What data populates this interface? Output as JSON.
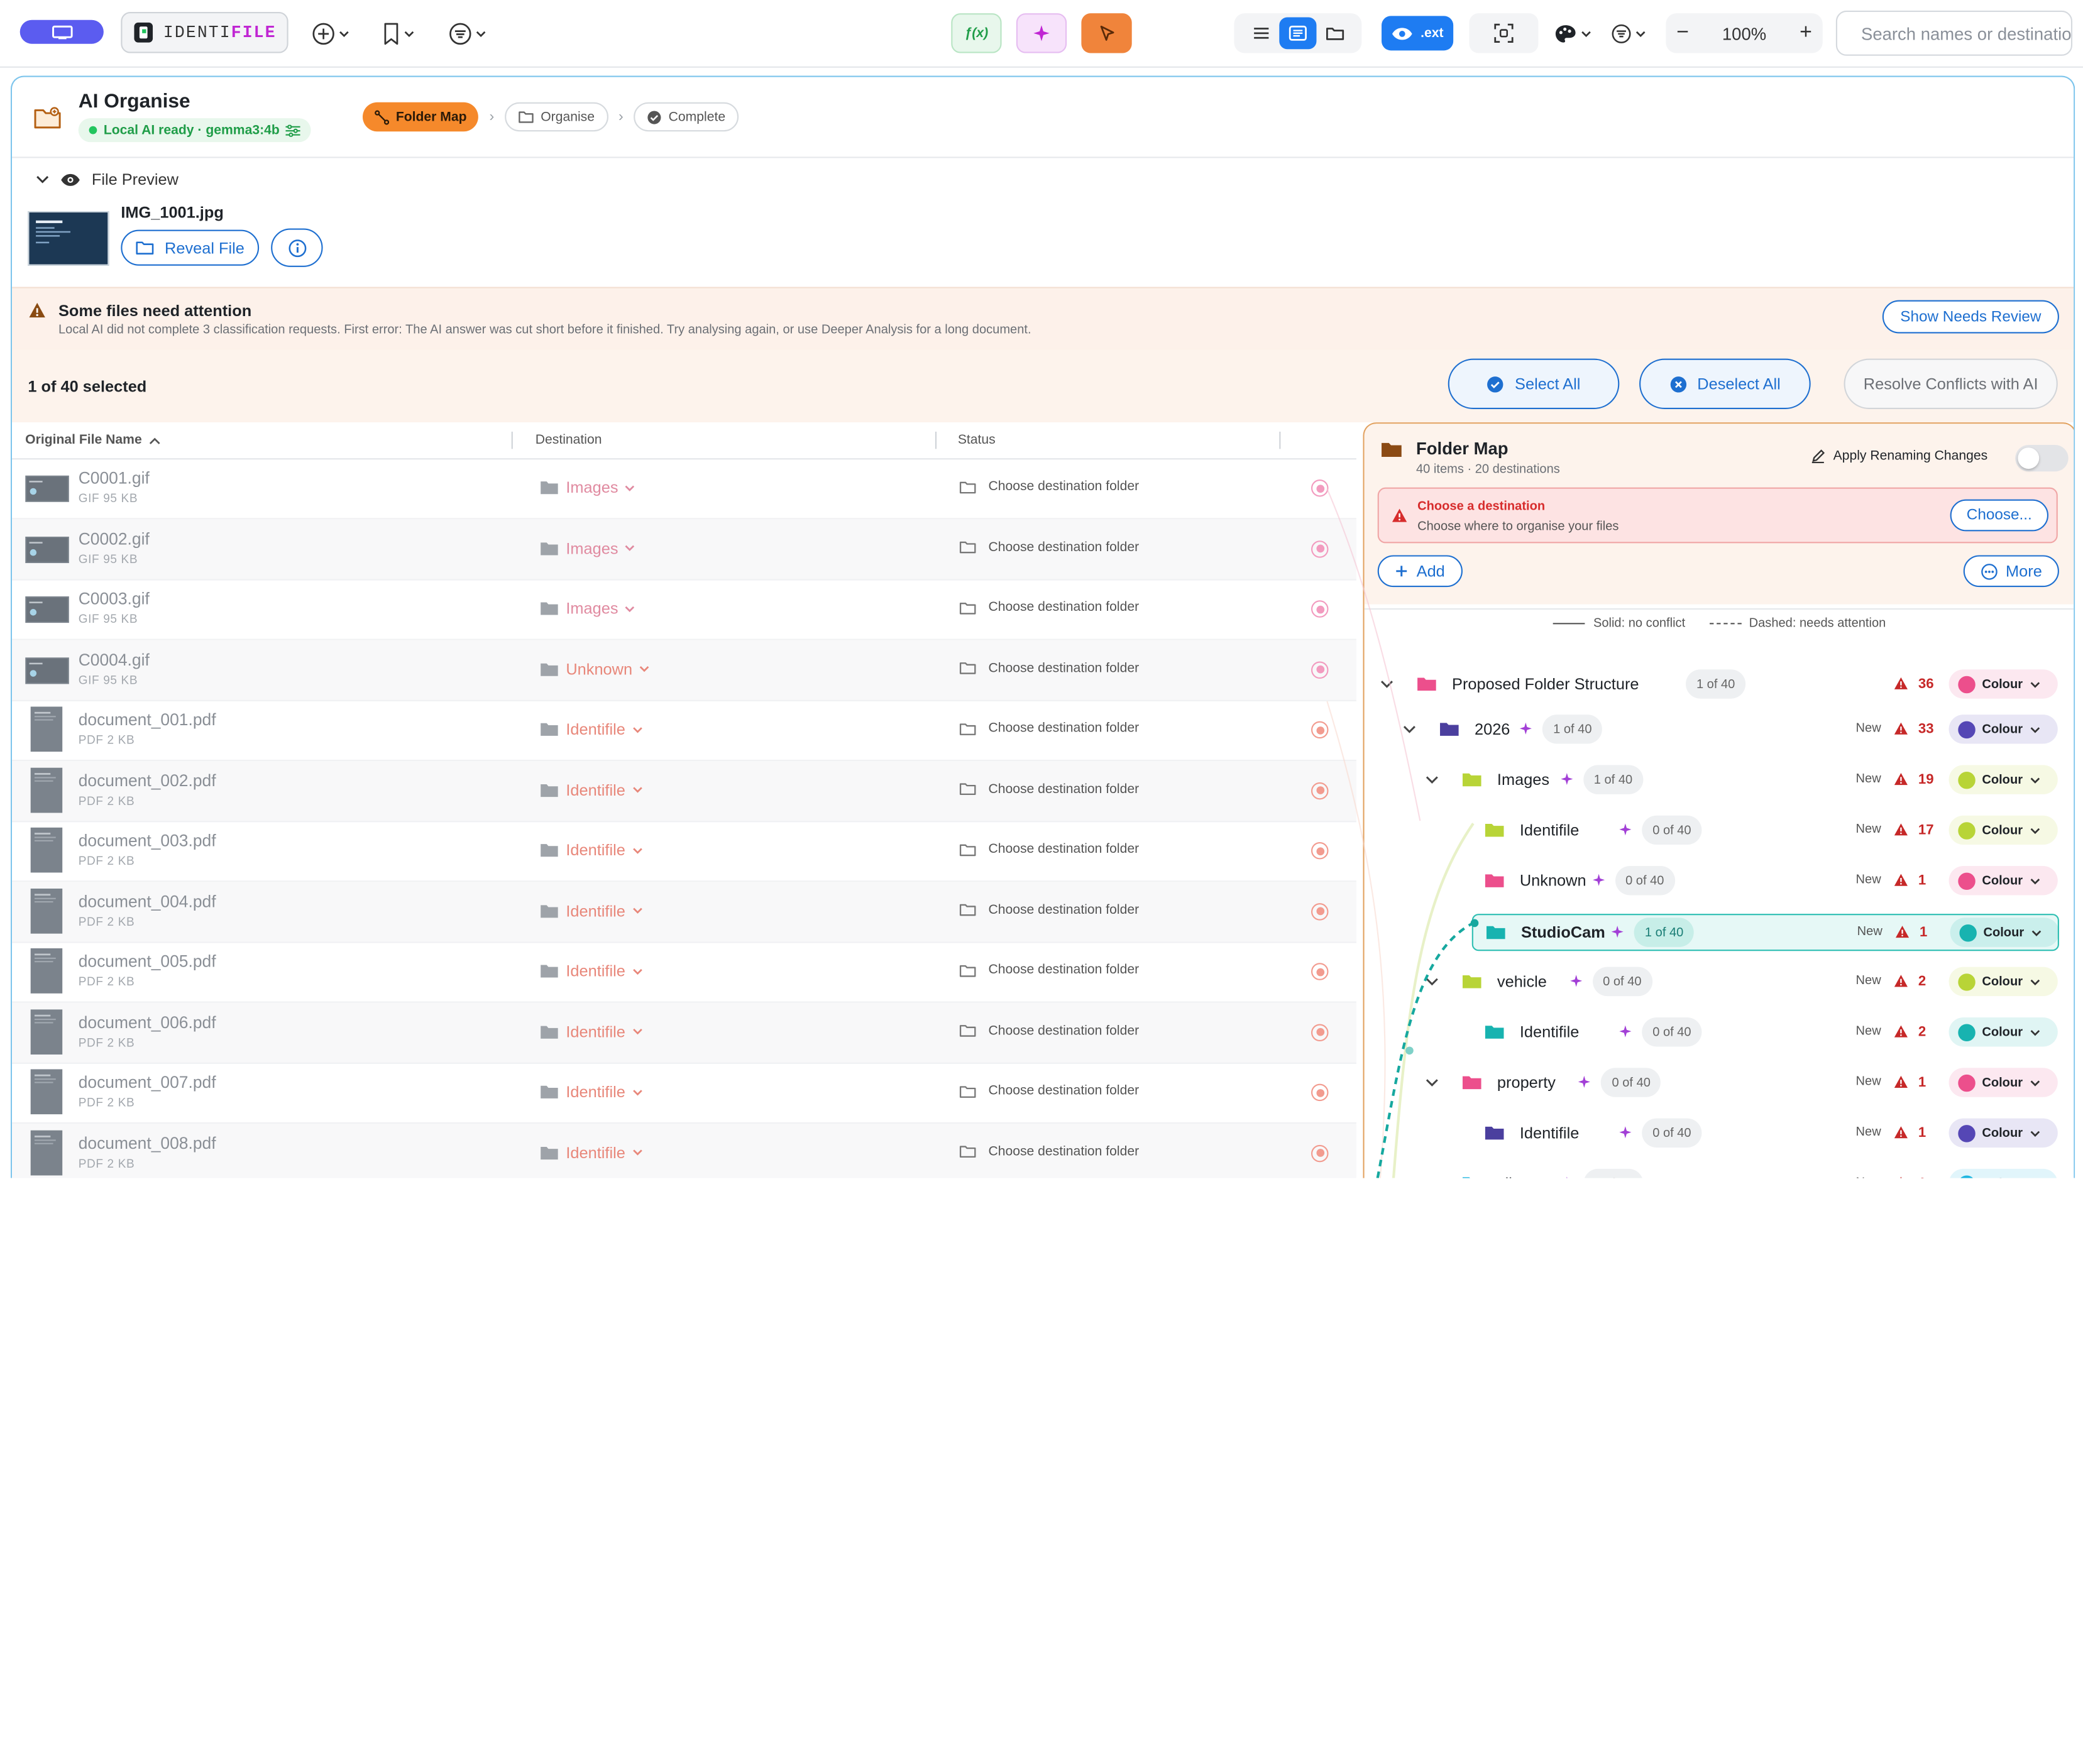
{
  "toolbar": {
    "brand_prefix": "IDENTI",
    "brand_suffix": "FILE",
    "fx_label": "ƒ(x)",
    "ext_label": ".ext",
    "zoom_minus": "−",
    "zoom_value": "100%",
    "zoom_plus": "+",
    "search_placeholder": "Search names or destinations"
  },
  "header": {
    "title": "AI Organise",
    "ai_status": "Local AI ready · gemma3:4b",
    "steps": [
      "Folder Map",
      "Organise",
      "Complete"
    ]
  },
  "preview": {
    "label": "File Preview",
    "file_name": "IMG_1001.jpg",
    "reveal_label": "Reveal File"
  },
  "warning": {
    "title": "Some files need attention",
    "message": "Local AI did not complete 3 classification requests. First error: The AI answer was cut short before it finished. Try analysing again, or use Deeper Analysis for a long document.",
    "button": "Show Needs Review"
  },
  "selection": {
    "count": "1 of 40 selected",
    "select_all": "Select All",
    "deselect_all": "Deselect All",
    "resolve": "Resolve Conflicts with AI"
  },
  "table": {
    "columns": [
      "Original File Name",
      "Destination",
      "Status"
    ],
    "status_text": "Choose destination folder",
    "rows": [
      {
        "name": "C0001.gif",
        "meta": "GIF  95 KB",
        "dest": "Images",
        "kind": "image"
      },
      {
        "name": "C0002.gif",
        "meta": "GIF  95 KB",
        "dest": "Images",
        "kind": "image"
      },
      {
        "name": "C0003.gif",
        "meta": "GIF  95 KB",
        "dest": "Images",
        "kind": "image"
      },
      {
        "name": "C0004.gif",
        "meta": "GIF  95 KB",
        "dest": "Unknown",
        "kind": "image"
      },
      {
        "name": "document_001.pdf",
        "meta": "PDF  2 KB",
        "dest": "Identifile",
        "kind": "pdf"
      },
      {
        "name": "document_002.pdf",
        "meta": "PDF  2 KB",
        "dest": "Identifile",
        "kind": "pdf"
      },
      {
        "name": "document_003.pdf",
        "meta": "PDF  2 KB",
        "dest": "Identifile",
        "kind": "pdf"
      },
      {
        "name": "document_004.pdf",
        "meta": "PDF  2 KB",
        "dest": "Identifile",
        "kind": "pdf"
      },
      {
        "name": "document_005.pdf",
        "meta": "PDF  2 KB",
        "dest": "Identifile",
        "kind": "pdf"
      },
      {
        "name": "document_006.pdf",
        "meta": "PDF  2 KB",
        "dest": "Identifile",
        "kind": "pdf"
      },
      {
        "name": "document_007.pdf",
        "meta": "PDF  2 KB",
        "dest": "Identifile",
        "kind": "pdf"
      },
      {
        "name": "document_008.pdf",
        "meta": "PDF  2 KB",
        "dest": "Identifile",
        "kind": "pdf"
      }
    ]
  },
  "folder_map": {
    "title": "Folder Map",
    "subtitle": "40 items · 20 destinations",
    "apply_label": "Apply Renaming Changes",
    "alert_title": "Choose a destination",
    "alert_message": "Choose where to organise your files",
    "choose_label": "Choose...",
    "add_label": "Add",
    "more_label": "More",
    "legend_solid": "Solid: no conflict",
    "legend_dashed": "Dashed: needs attention",
    "colour_label": "Colour",
    "new_label": "New",
    "tree": [
      {
        "name": "Proposed Folder Structure",
        "count": "1 of 40",
        "issues": "36",
        "folder_color": "#ec4f8c",
        "swatch": "#ec4f8c",
        "is_new": false,
        "spark": false
      },
      {
        "name": "2026",
        "count": "1 of 40",
        "issues": "33",
        "folder_color": "#4b3f9e",
        "swatch": "#5547b5",
        "is_new": true,
        "spark": true
      },
      {
        "name": "Images",
        "count": "1 of 40",
        "issues": "19",
        "folder_color": "#b8d437",
        "swatch": "#b8d437",
        "is_new": true,
        "spark": true
      },
      {
        "name": "Identifile",
        "count": "0 of 40",
        "issues": "17",
        "folder_color": "#b8d437",
        "swatch": "#b8d437",
        "is_new": true,
        "spark": true
      },
      {
        "name": "Unknown",
        "count": "0 of 40",
        "issues": "1",
        "folder_color": "#ec4f8c",
        "swatch": "#ec4f8c",
        "is_new": true,
        "spark": true
      },
      {
        "name": "StudioCam",
        "count": "1 of 40",
        "issues": "1",
        "folder_color": "#18b3b0",
        "swatch": "#18b3b0",
        "is_new": true,
        "spark": true
      },
      {
        "name": "vehicle",
        "count": "0 of 40",
        "issues": "2",
        "folder_color": "#b8d437",
        "swatch": "#b8d437",
        "is_new": true,
        "spark": true
      },
      {
        "name": "Identifile",
        "count": "0 of 40",
        "issues": "2",
        "folder_color": "#18b3b0",
        "swatch": "#18b3b0",
        "is_new": true,
        "spark": true
      },
      {
        "name": "property",
        "count": "0 of 40",
        "issues": "1",
        "folder_color": "#ec4f8c",
        "swatch": "#ec4f8c",
        "is_new": true,
        "spark": true
      },
      {
        "name": "Identifile",
        "count": "0 of 40",
        "issues": "1",
        "folder_color": "#4b3f9e",
        "swatch": "#5547b5",
        "is_new": true,
        "spark": true
      },
      {
        "name": "client",
        "count": "0 of 40",
        "issues": "1",
        "folder_color": "#20b6e0",
        "swatch": "#20b6e0",
        "is_new": true,
        "spark": true
      }
    ]
  },
  "colors": {
    "accent_blue": "#1e6fd0",
    "step_active": "#f5892b",
    "panel_border": "#7cc4ec",
    "map_border": "#e2a15f"
  }
}
